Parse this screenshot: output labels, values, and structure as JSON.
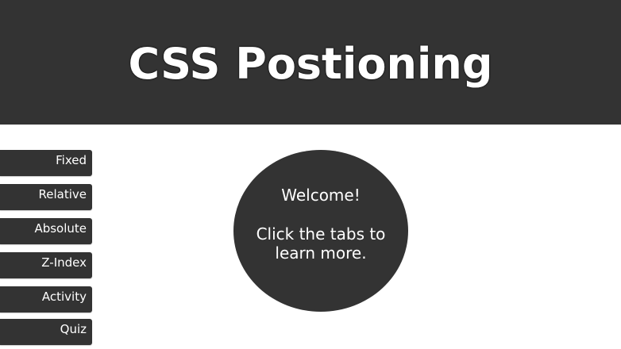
{
  "header": {
    "title": "CSS Postioning",
    "background_color": "#333333"
  },
  "tabs": [
    {
      "label": "Fixed"
    },
    {
      "label": "Relative"
    },
    {
      "label": "Absolute"
    },
    {
      "label": "Z-Index"
    },
    {
      "label": "Activity"
    },
    {
      "label": "Quiz"
    }
  ],
  "welcome": {
    "title": "Welcome!",
    "body": "Click the tabs to learn more."
  },
  "colors": {
    "dark": "#333333",
    "text_light": "#ffffff",
    "page_background": "#ffffff"
  }
}
